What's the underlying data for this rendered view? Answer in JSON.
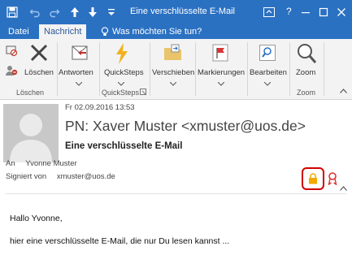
{
  "window": {
    "title": "Eine verschlüsselte E-Mail",
    "question_btn": "?"
  },
  "tabs": [
    {
      "label": "Datei"
    },
    {
      "label": "Nachricht"
    }
  ],
  "tell_me": "Was möchten Sie tun?",
  "ribbon": {
    "loeschen_btn": "Löschen",
    "antworten_btn": "Antworten",
    "quicksteps_btn": "QuickSteps",
    "verschieben_btn": "Verschieben",
    "markierungen_btn": "Markierungen",
    "bearbeiten_btn": "Bearbeiten",
    "zoom_btn": "Zoom",
    "group_loeschen": "Löschen",
    "group_quicksteps": "QuickSteps",
    "group_zoom": "Zoom"
  },
  "message": {
    "date": "Fr 02.09.2016 13:53",
    "from": "PN: Xaver Muster <xmuster@uos.de>",
    "subject": "Eine verschlüsselte E-Mail",
    "to_label": "An",
    "to_value": "Yvonne Muster",
    "signed_label": "Signiert von",
    "signed_value": "xmuster@uos.de"
  },
  "body": {
    "greeting": "Hallo Yvonne,",
    "line1": "hier eine verschlüsselte E-Mail, die nur Du lesen kannst ..."
  },
  "colors": {
    "titlebar": "#2b71c2",
    "lock": "#f2a900",
    "highlight": "#d00000"
  }
}
